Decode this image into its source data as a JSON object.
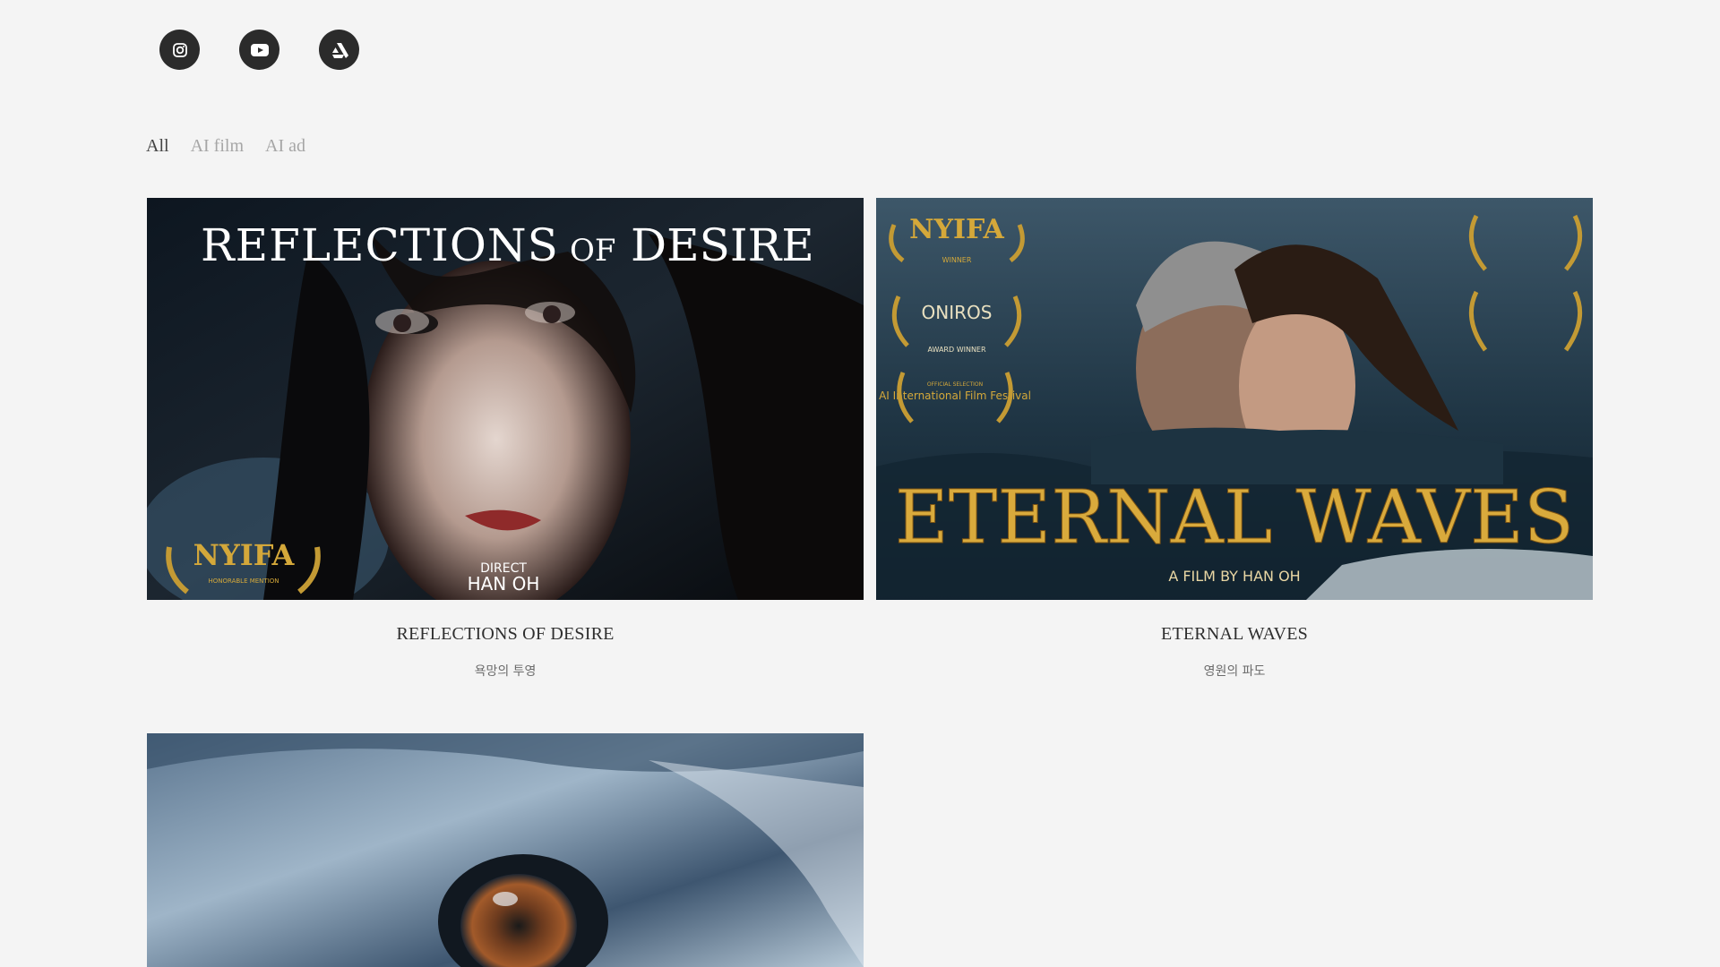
{
  "social": [
    {
      "name": "instagram-icon"
    },
    {
      "name": "youtube-icon"
    },
    {
      "name": "artstation-icon"
    }
  ],
  "filters": [
    {
      "label": "All",
      "active": true
    },
    {
      "label": "AI film",
      "active": false
    },
    {
      "label": "AI ad",
      "active": false
    }
  ],
  "projects": [
    {
      "poster_title_1": "REFLECTIONS",
      "poster_title_2": "OF",
      "poster_title_3": "DESIRE",
      "poster_credit_label": "DIRECT",
      "poster_credit_name": "HAN OH",
      "laurel_text": "NYIFA",
      "laurel_sub": "HONORABLE MENTION",
      "title": "REFLECTIONS OF DESIRE",
      "subtitle": "욕망의 투영"
    },
    {
      "poster_title": "ETERNAL WAVES",
      "poster_credit": "A FILM BY  HAN OH",
      "laurels": [
        "NYIFA",
        "WINNER",
        "ONIROS",
        "AWARD WINNER",
        "AI International Film Festival",
        "OFFICIAL SELECTION"
      ],
      "title": "ETERNAL WAVES",
      "subtitle": "영원의 파도"
    },
    {
      "title": "",
      "subtitle": ""
    }
  ],
  "colors": {
    "background": "#f4f4f4",
    "icon_bg": "#2b2b2b",
    "filter_active": "#444444",
    "filter_inactive": "#a6a6a6",
    "gold": "#d4a83a"
  }
}
